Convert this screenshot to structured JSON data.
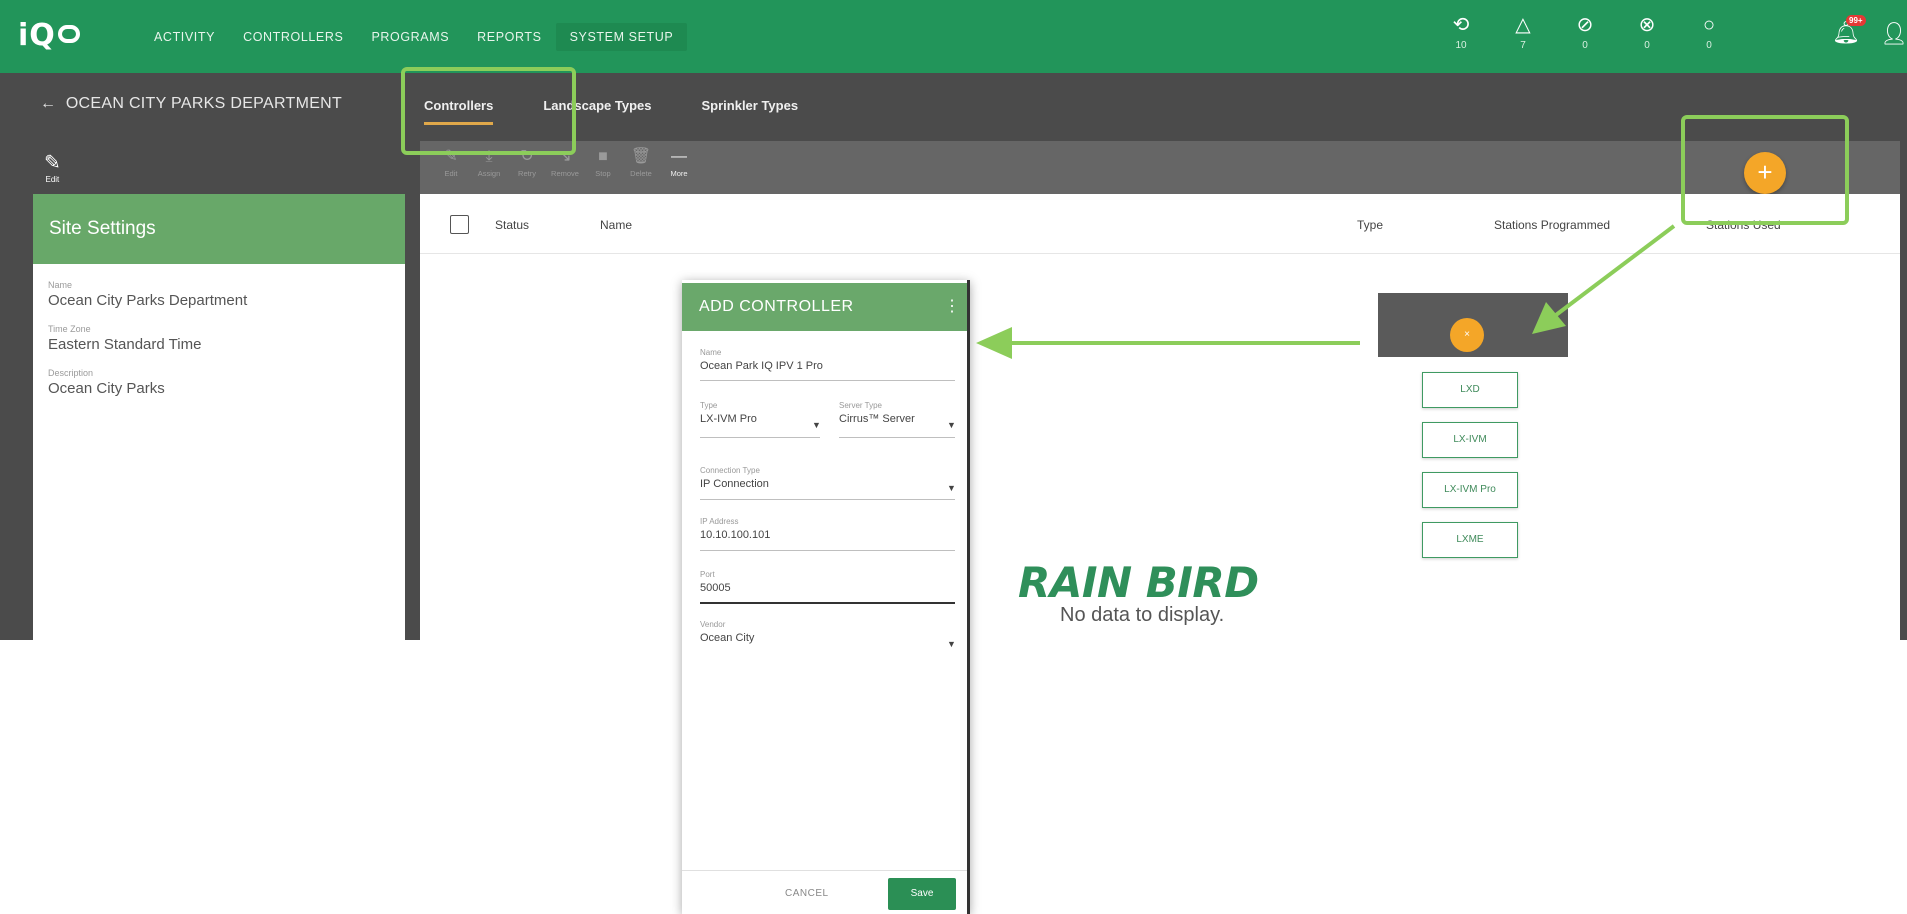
{
  "app": {
    "logo": "iQ",
    "nav": [
      "ACTIVITY",
      "CONTROLLERS",
      "PROGRAMS",
      "REPORTS",
      "SYSTEM SETUP"
    ],
    "status_icons": [
      {
        "icon": "sync-icon",
        "glyph": "⟲",
        "count": "10"
      },
      {
        "icon": "warning-icon",
        "glyph": "△",
        "count": "7"
      },
      {
        "icon": "blocked-icon",
        "glyph": "⊘",
        "count": "0"
      },
      {
        "icon": "error-icon",
        "glyph": "⊗",
        "count": "0"
      },
      {
        "icon": "pending-icon",
        "glyph": "○",
        "count": "0"
      }
    ],
    "notification_badge": "99+"
  },
  "site": {
    "back_label": "OCEAN CITY PARKS DEPARTMENT",
    "edit_label": "Edit",
    "tabs": [
      "Controllers",
      "Landscape Types",
      "Sprinkler Types"
    ],
    "tools": [
      "Edit",
      "Assign",
      "Retry",
      "Remove",
      "Stop",
      "Delete",
      "More"
    ],
    "settings": {
      "title": "Site Settings",
      "fields": [
        {
          "label": "Name",
          "value": "Ocean City Parks Department"
        },
        {
          "label": "Time Zone",
          "value": "Eastern Standard Time"
        },
        {
          "label": "Description",
          "value": "Ocean City Parks"
        }
      ]
    }
  },
  "table": {
    "columns": [
      "Status",
      "Name",
      "Type",
      "Stations Programmed",
      "Stations Used"
    ],
    "empty_message": "No data to display.",
    "brand": "RAIN BIRD"
  },
  "modal": {
    "title": "ADD CONTROLLER",
    "fields": {
      "name": {
        "label": "Name",
        "value": "Ocean Park IQ IPV 1 Pro"
      },
      "type": {
        "label": "Type",
        "value": "LX-IVM Pro"
      },
      "server": {
        "label": "Server Type",
        "value": "Cirrus™ Server"
      },
      "connection": {
        "label": "Connection Type",
        "value": "IP Connection"
      },
      "ip": {
        "label": "IP Address",
        "value": "10.10.100.101"
      },
      "port": {
        "label": "Port",
        "value": "50005"
      },
      "vendor": {
        "label": "Vendor",
        "value": "Ocean City"
      }
    },
    "cancel": "CANCEL",
    "save": "Save"
  },
  "controller_types": [
    "LXD",
    "LX-IVM",
    "LX-IVM Pro",
    "LXME"
  ],
  "colors": {
    "brand_green": "#22955a",
    "accent_orange": "#f4a628",
    "annotation_green": "#8ccd5a"
  }
}
